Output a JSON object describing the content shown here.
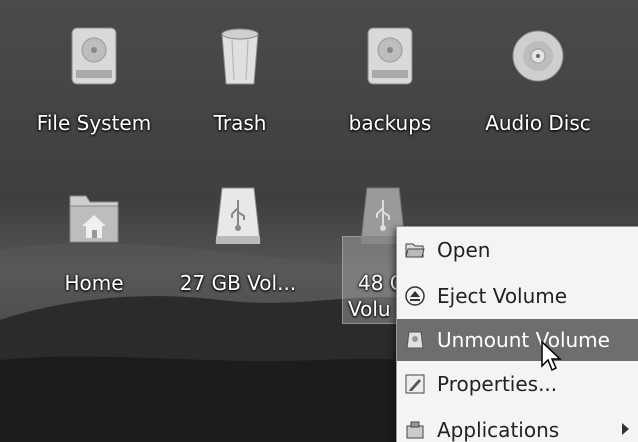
{
  "desktop": {
    "icons": [
      {
        "label": "File System",
        "icon": "hard-drive"
      },
      {
        "label": "Trash",
        "icon": "trash-can"
      },
      {
        "label": "backups",
        "icon": "hard-drive"
      },
      {
        "label": "Audio Disc",
        "icon": "optical-disc"
      },
      {
        "label": "Home",
        "icon": "home-folder"
      },
      {
        "label": "27 GB Vol...",
        "icon": "usb-drive"
      },
      {
        "label_line1": "48 G",
        "label_line2": "Volu",
        "icon": "usb-drive",
        "selected": true
      }
    ]
  },
  "context_menu": {
    "items": [
      {
        "label": "Open",
        "icon": "open-icon"
      },
      {
        "label": "Eject Volume",
        "icon": "eject-icon"
      },
      {
        "label": "Unmount Volume",
        "icon": "unmount-icon",
        "highlighted": true
      },
      {
        "label": "Properties...",
        "icon": "properties-icon"
      },
      {
        "label": "Applications",
        "icon": "applications-icon",
        "submenu": true
      }
    ]
  }
}
